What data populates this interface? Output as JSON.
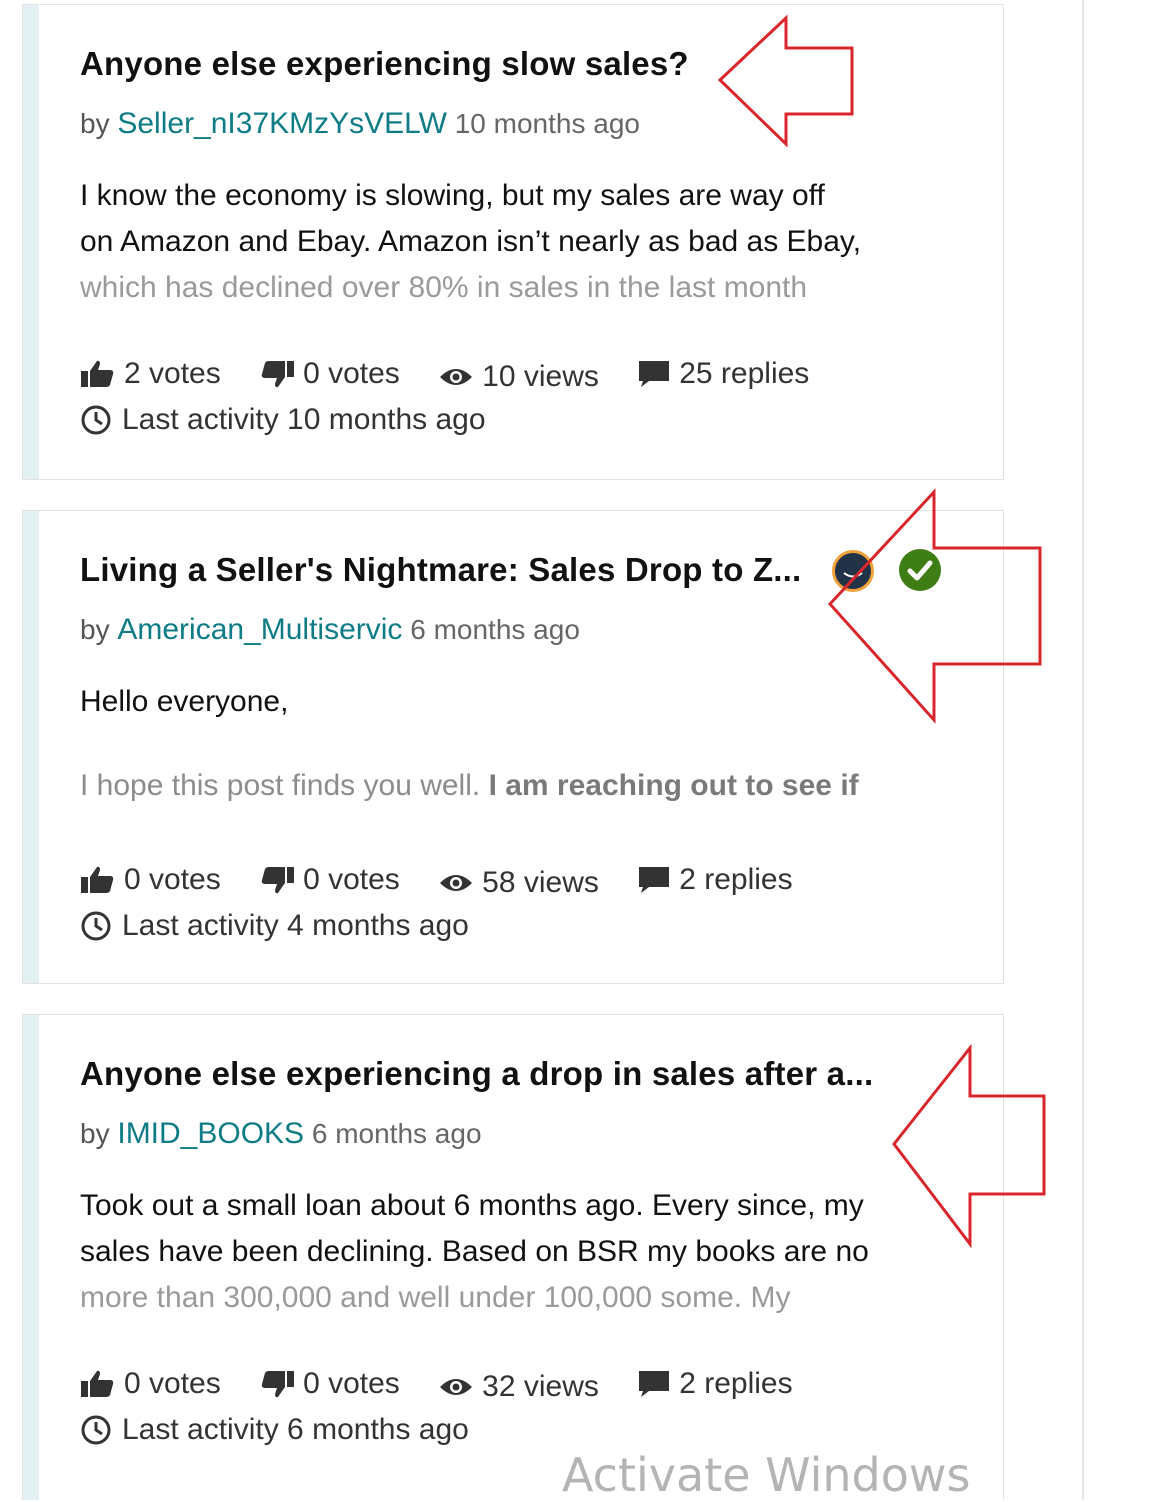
{
  "posts": [
    {
      "title": "Anyone else experiencing slow sales?",
      "by_prefix": "by",
      "author": "Seller_nI37KMzYsVELW",
      "posted": "10 months ago",
      "body_line1": "I know the economy is slowing, but my sales are way off",
      "body_line2": "on Amazon and Ebay. Amazon isn’t nearly as bad as Ebay,",
      "body_line3": "which has declined over 80% in sales in the last month",
      "upvotes": "2 votes",
      "downvotes": "0 votes",
      "views": "10 views",
      "replies": "25 replies",
      "last_activity": "Last activity 10 months ago"
    },
    {
      "title": "Living a Seller's Nightmare: Sales Drop to Z...",
      "by_prefix": "by",
      "author": "American_Multiservic",
      "posted": "6 months ago",
      "body_line1": "Hello everyone,",
      "body_line3a": "I hope this post finds you well. ",
      "body_line3b": "I am reaching out to see if",
      "upvotes": "0 votes",
      "downvotes": "0 votes",
      "views": "58 views",
      "replies": "2 replies",
      "last_activity": "Last activity 4 months ago"
    },
    {
      "title": "Anyone else experiencing a drop in sales after a...",
      "by_prefix": "by",
      "author": "IMID_BOOKS",
      "posted": "6 months ago",
      "body_line1": "Took out a small loan about 6 months ago. Every since, my",
      "body_line2": "sales have been declining. Based on BSR my books are no",
      "body_line3": "more than 300,000 and well under 100,000 some. My",
      "upvotes": "0 votes",
      "downvotes": "0 votes",
      "views": "32 views",
      "replies": "2 replies",
      "last_activity": "Last activity 6 months ago"
    }
  ],
  "watermark": "Activate Windows",
  "colors": {
    "author_link": "#0e7c86",
    "card_accent": "#e3f1f2",
    "annotation_arrow": "#d9262c",
    "accepted_badge": "#3e7d13"
  },
  "icons": [
    "thumbs-up-icon",
    "thumbs-down-icon",
    "eye-icon",
    "comment-icon",
    "clock-icon",
    "avatar-badge-icon",
    "check-badge-icon",
    "red-arrow-annotation"
  ]
}
